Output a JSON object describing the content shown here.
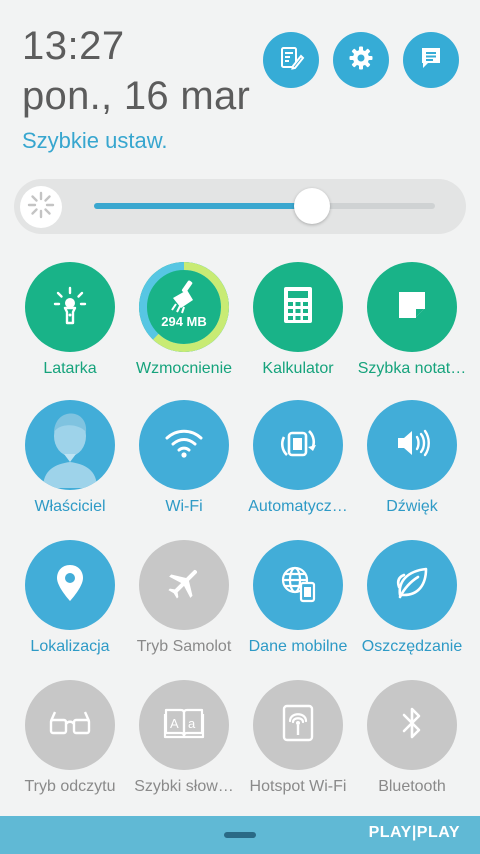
{
  "header": {
    "time": "13:27",
    "date": "pon., 16 mar",
    "quick_settings_link": "Szybkie ustaw.",
    "buttons": [
      {
        "icon": "edit-list-icon"
      },
      {
        "icon": "gear-icon"
      },
      {
        "icon": "notes-icon"
      }
    ]
  },
  "brightness": {
    "level": 0.64,
    "icon": "brightness-auto-icon"
  },
  "tiles": [
    {
      "label": "Latarka",
      "icon": "flashlight-icon",
      "state": "on"
    },
    {
      "label": "Wzmocnienie",
      "icon": "broom-icon",
      "state": "on",
      "badge": "294 MB",
      "ring_fill": 0.62
    },
    {
      "label": "Kalkulator",
      "icon": "calculator-icon",
      "state": "on"
    },
    {
      "label": "Szybka notat…",
      "icon": "quick-memo-icon",
      "state": "on"
    },
    {
      "label": "Właściciel",
      "icon": "owner-avatar-icon",
      "state": "active"
    },
    {
      "label": "Wi-Fi",
      "icon": "wifi-icon",
      "state": "active"
    },
    {
      "label": "Automatycz…",
      "icon": "auto-rotate-icon",
      "state": "active"
    },
    {
      "label": "Dźwięk",
      "icon": "speaker-icon",
      "state": "active"
    },
    {
      "label": "Lokalizacja",
      "icon": "location-pin-icon",
      "state": "active"
    },
    {
      "label": "Tryb Samolot",
      "icon": "airplane-icon",
      "state": "off"
    },
    {
      "label": "Dane mobilne",
      "icon": "mobile-data-icon",
      "state": "active"
    },
    {
      "label": "Oszczędzanie",
      "icon": "leaf-icon",
      "state": "active"
    },
    {
      "label": "Tryb odczytu",
      "icon": "reading-glasses-icon",
      "state": "off"
    },
    {
      "label": "Szybki słow…",
      "icon": "dictionary-icon",
      "state": "off"
    },
    {
      "label": "Hotspot Wi-Fi",
      "icon": "hotspot-icon",
      "state": "off"
    },
    {
      "label": "Bluetooth",
      "icon": "bluetooth-icon",
      "state": "off"
    }
  ],
  "bottom_bar": {
    "carrier": "PLAY|PLAY"
  },
  "colors": {
    "accent_blue": "#42add8",
    "accent_green": "#19b388",
    "inactive_grey": "#c7c7c7",
    "background": "#f2f3f3"
  }
}
